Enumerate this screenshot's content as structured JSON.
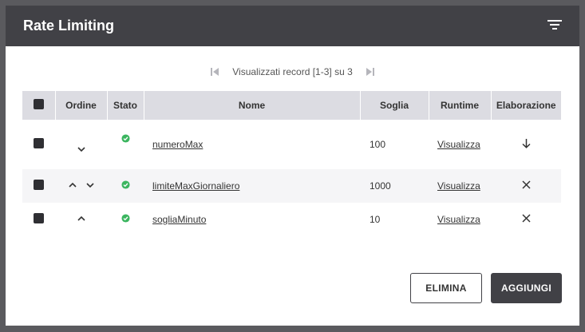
{
  "dialog": {
    "title": "Rate Limiting"
  },
  "pager": {
    "text": "Visualizzati record [1-3] su 3"
  },
  "table": {
    "columns": [
      "Ordine",
      "Stato",
      "Nome",
      "Soglia",
      "Runtime",
      "Elaborazione"
    ],
    "rows": [
      {
        "nome": "numeroMax",
        "soglia": "100",
        "runtime": "Visualizza",
        "order_up": false,
        "order_down": true,
        "elaborazione": "arrow-down"
      },
      {
        "nome": "limiteMaxGiornaliero",
        "soglia": "1000",
        "runtime": "Visualizza",
        "order_up": true,
        "order_down": true,
        "elaborazione": "close"
      },
      {
        "nome": "sogliaMinuto",
        "soglia": "10",
        "runtime": "Visualizza",
        "order_up": true,
        "order_down": false,
        "elaborazione": "close"
      }
    ]
  },
  "buttons": {
    "elimina": "ELIMINA",
    "aggiungi": "AGGIUNGI"
  },
  "colors": {
    "header_bg": "#414146",
    "status_ok": "#3bb55f",
    "table_header_bg": "#dcdce2"
  }
}
